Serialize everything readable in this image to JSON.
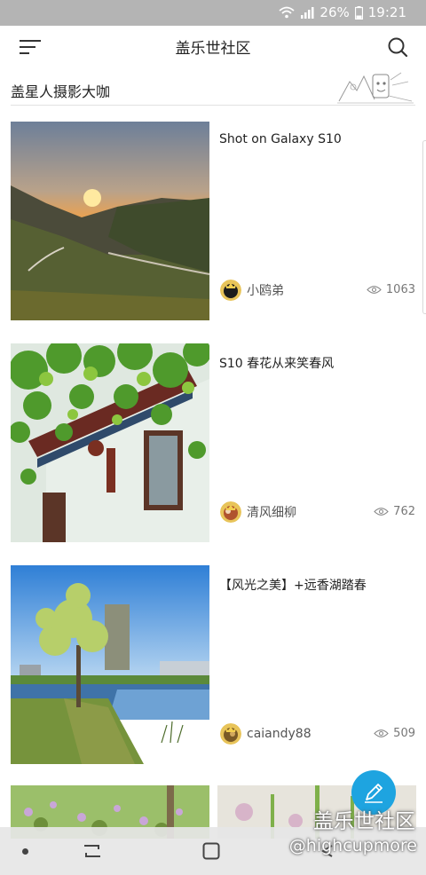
{
  "status_bar": {
    "battery": "26%",
    "time": "19:21"
  },
  "header": {
    "title": "盖乐世社区"
  },
  "section": {
    "title": "盖星人摄影大咖"
  },
  "posts": [
    {
      "title": "Shot on Galaxy S10",
      "author": "小鸥弟",
      "views": "1063"
    },
    {
      "title": "S10 春花从来笑春风",
      "author": "清风细柳",
      "views": "762"
    },
    {
      "title": "【风光之美】+远香湖踏春",
      "author": "caiandy88",
      "views": "509"
    }
  ],
  "watermark": {
    "brand": "盖乐世社区",
    "handle": "@highcupmore"
  },
  "colors": {
    "fab": "#1ea4e0",
    "status_bar": "#b4b4b4"
  }
}
